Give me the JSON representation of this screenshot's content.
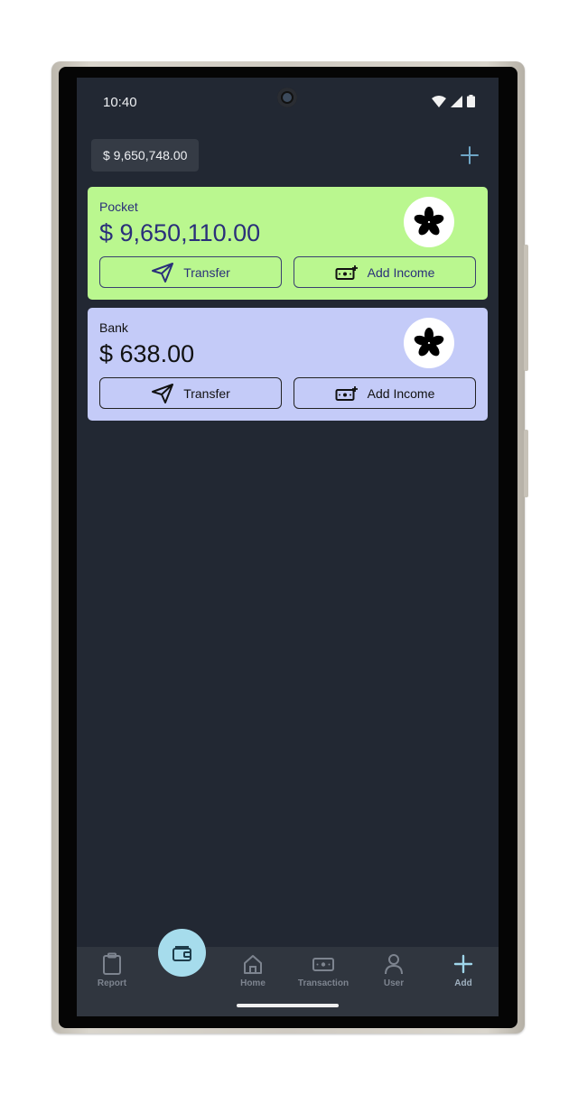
{
  "status": {
    "time": "10:40"
  },
  "header": {
    "total": "$ 9,650,748.00"
  },
  "accounts": [
    {
      "name": "Pocket",
      "amount": "$ 9,650,110.00",
      "transfer_label": "Transfer",
      "income_label": "Add Income",
      "color": "#baf78f"
    },
    {
      "name": "Bank",
      "amount": "$ 638.00",
      "transfer_label": "Transfer",
      "income_label": "Add Income",
      "color": "#c4cbf8"
    }
  ],
  "nav": {
    "items": [
      {
        "label": "Report",
        "icon": "clipboard-icon"
      },
      {
        "label": "",
        "icon": "wallet-icon"
      },
      {
        "label": "Home",
        "icon": "home-icon"
      },
      {
        "label": "Transaction",
        "icon": "cash-icon"
      },
      {
        "label": "User",
        "icon": "user-icon"
      },
      {
        "label": "Add",
        "icon": "plus-icon"
      }
    ]
  },
  "colors": {
    "background": "#222833",
    "accent": "#a6dcec",
    "nav_bg": "#30363f"
  }
}
